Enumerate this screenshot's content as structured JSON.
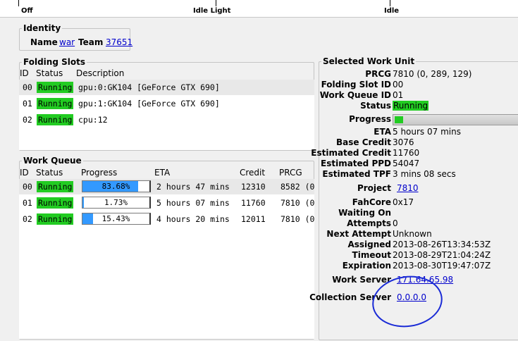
{
  "slider": {
    "labels": [
      "Off",
      "Idle Light",
      "Idle"
    ]
  },
  "identity": {
    "legend": "Identity",
    "name_label": "Name",
    "name_value": "war",
    "team_label": "Team",
    "team_value": "37651"
  },
  "folding_slots": {
    "legend": "Folding Slots",
    "columns": [
      "ID",
      "Status",
      "Description"
    ],
    "rows": [
      {
        "id": "00",
        "status": "Running",
        "description": "gpu:0:GK104 [GeForce GTX 690]"
      },
      {
        "id": "01",
        "status": "Running",
        "description": "gpu:1:GK104 [GeForce GTX 690]"
      },
      {
        "id": "02",
        "status": "Running",
        "description": "cpu:12"
      }
    ]
  },
  "work_queue": {
    "legend": "Work Queue",
    "columns": [
      "ID",
      "Status",
      "Progress",
      "ETA",
      "Credit",
      "PRCG"
    ],
    "rows": [
      {
        "id": "00",
        "status": "Running",
        "progress_text": "83.68%",
        "progress": 0.8368,
        "eta": "2 hours 47 mins",
        "credit": "12310",
        "prcg": "8582 (0"
      },
      {
        "id": "01",
        "status": "Running",
        "progress_text": "1.73%",
        "progress": 0.0173,
        "eta": "5 hours 07 mins",
        "credit": "11760",
        "prcg": "7810 (0"
      },
      {
        "id": "02",
        "status": "Running",
        "progress_text": "15.43%",
        "progress": 0.1543,
        "eta": "4 hours 20 mins",
        "credit": "12011",
        "prcg": "7810 (0"
      }
    ]
  },
  "selected_wu": {
    "legend": "Selected Work Unit",
    "prcg_label": "PRCG",
    "prcg": "7810 (0, 289, 129)",
    "slot_label": "Folding Slot ID",
    "slot": "00",
    "queue_label": "Work Queue ID",
    "queue": "01",
    "status_label": "Status",
    "status": "Running",
    "progress_label": "Progress",
    "progress": 0.0173,
    "eta_label": "ETA",
    "eta": "5 hours 07 mins",
    "base_credit_label": "Base Credit",
    "base_credit": "3076",
    "est_credit_label": "Estimated Credit",
    "est_credit": "11760",
    "est_ppd_label": "Estimated PPD",
    "est_ppd": "54047",
    "est_tpf_label": "Estimated TPF",
    "est_tpf": "3 mins 08 secs",
    "project_label": "Project",
    "project": "7810",
    "fahcore_label": "FahCore",
    "fahcore": "0x17",
    "waiting_label": "Waiting On",
    "waiting": "",
    "attempts_label": "Attempts",
    "attempts": "0",
    "next_attempt_label": "Next Attempt",
    "next_attempt": "Unknown",
    "assigned_label": "Assigned",
    "assigned": "2013-08-26T13:34:53Z",
    "timeout_label": "Timeout",
    "timeout": "2013-08-29T21:04:24Z",
    "expiration_label": "Expiration",
    "expiration": "2013-08-30T19:47:07Z",
    "ws_label": "Work Server",
    "ws": "171.64.65.98",
    "cs_label": "Collection Server",
    "cs": "0.0.0.0"
  },
  "colors": {
    "running": "#22cc22",
    "progress_fill": "#3399ff",
    "link": "#0000cc",
    "annotation": "#1a2bd6"
  }
}
